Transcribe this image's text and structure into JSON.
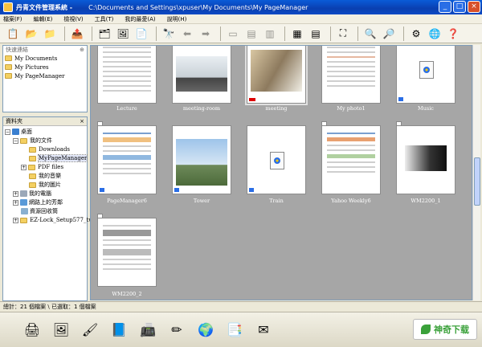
{
  "window": {
    "title": "丹青文件管理系統 -",
    "path": "C:\\Documents and Settings\\xpuser\\My Documents\\My PageManager",
    "buttons": [
      "_",
      "□",
      "×"
    ]
  },
  "menu": [
    "檔案(F)",
    "編輯(E)",
    "檢視(V)",
    "工具(T)",
    "我的最愛(A)",
    "說明(H)"
  ],
  "quick": {
    "title": "快速連結",
    "items": [
      "My Documents",
      "My Pictures",
      "My PageManager"
    ]
  },
  "tree": {
    "title": "資料夾",
    "close": "×",
    "nodes": [
      {
        "label": "桌面"
      },
      {
        "label": "我的文件"
      },
      {
        "label": "Downloads"
      },
      {
        "label": "MyPageManager"
      },
      {
        "label": "PDF files"
      },
      {
        "label": "我的音樂"
      },
      {
        "label": "我的圖片"
      },
      {
        "label": "我的電腦"
      },
      {
        "label": "網路上的芳鄰"
      },
      {
        "label": "資源回收筒"
      },
      {
        "label": "EZ-Lock_Setup577_tw"
      }
    ]
  },
  "thumbnails": [
    {
      "name": "Lecture"
    },
    {
      "name": "meeting-room"
    },
    {
      "name": "meeting"
    },
    {
      "name": "My photo1"
    },
    {
      "name": "Music"
    },
    {
      "name": "PageManager6"
    },
    {
      "name": "Tower"
    },
    {
      "name": "Train"
    },
    {
      "name": "Yahoo Weekly6"
    },
    {
      "name": "WM2200_1"
    },
    {
      "name": "WM2200_2"
    }
  ],
  "status": "總計：21 個檔案  \\ 已選取：1 個檔案",
  "brand": "神奇下载",
  "colors": {
    "title_bar": "#0a4fc4",
    "content_bg": "#a6a6a6",
    "selection": "#e1e6f7"
  }
}
